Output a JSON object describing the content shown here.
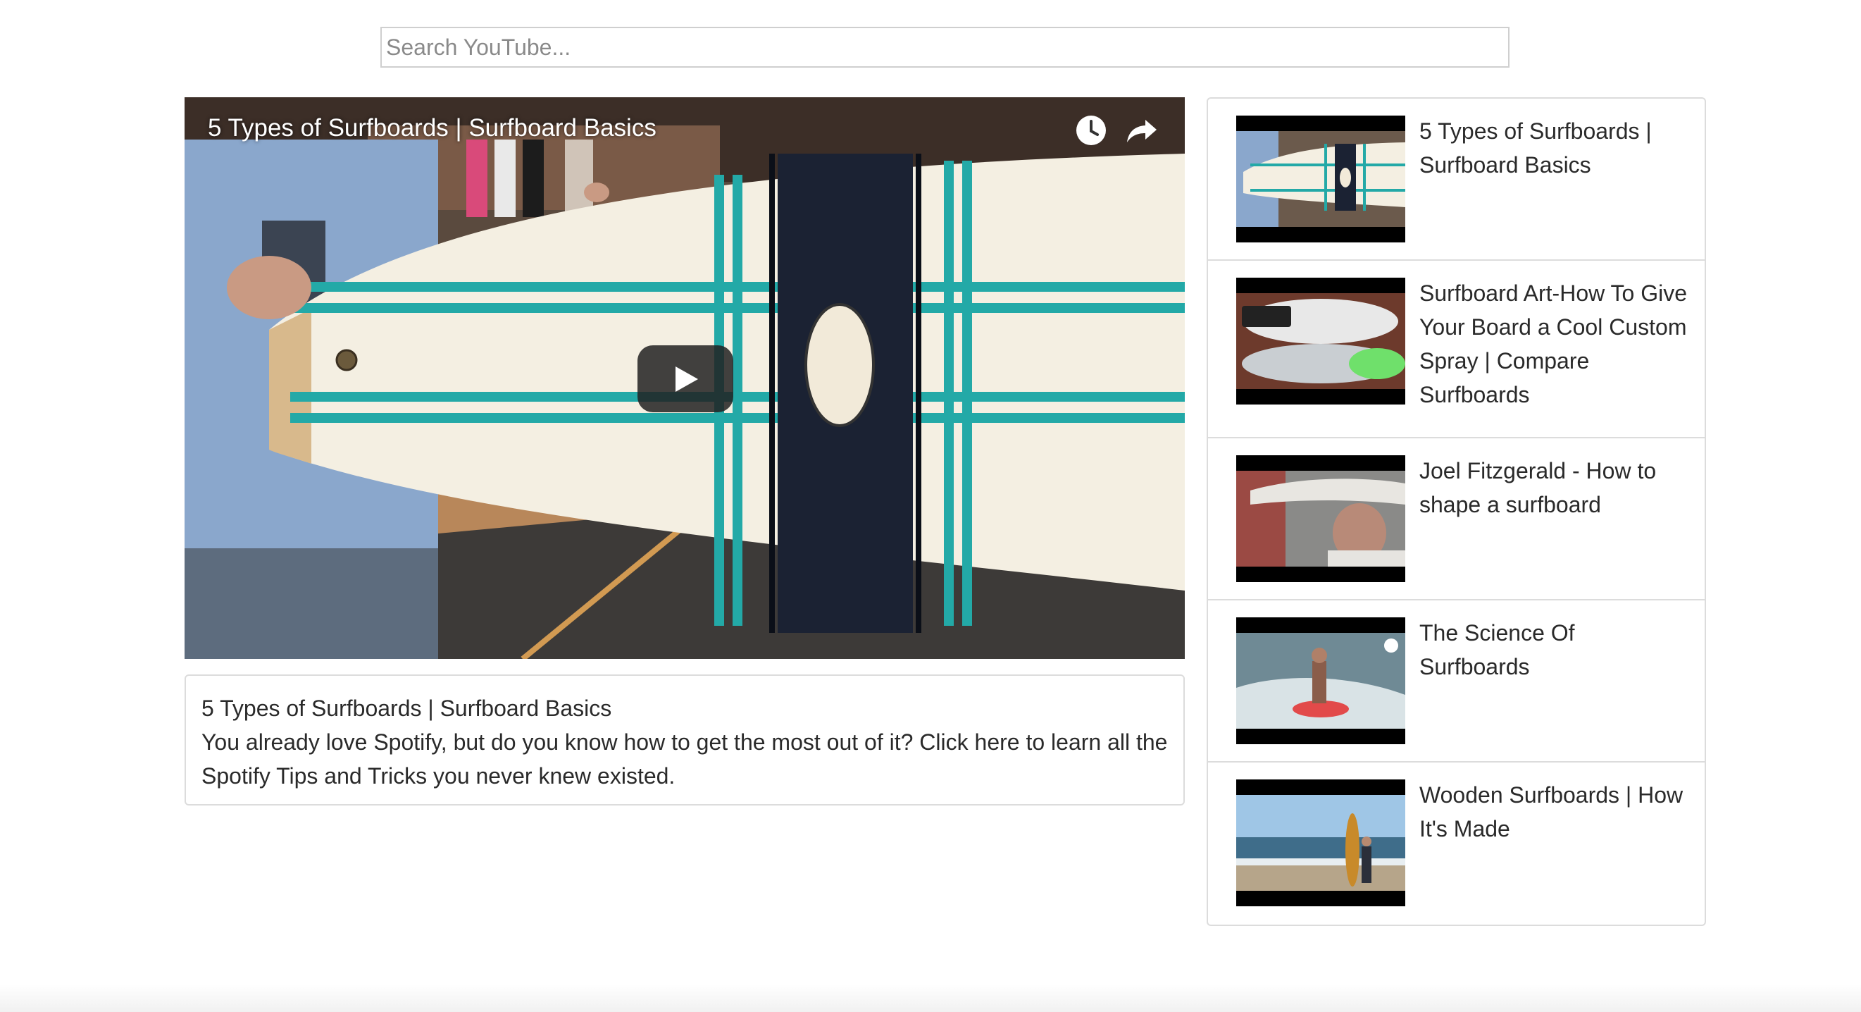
{
  "search": {
    "placeholder": "Search YouTube..."
  },
  "player": {
    "title": "5 Types of Surfboards | Surfboard Basics",
    "watch_later_icon": "clock-icon",
    "share_icon": "share-arrow-icon",
    "play_icon": "play-icon"
  },
  "details": {
    "title": "5 Types of Surfboards | Surfboard Basics",
    "description": "You already love Spotify, but do you know how to get the most out of it? Click here to learn all the Spotify Tips and Tricks you never knew existed."
  },
  "video_list": [
    {
      "title": "5 Types of Surfboards | Surfboard Basics"
    },
    {
      "title": "Surfboard Art-How To Give Your Board a Cool Custom Spray | Compare Surfboards"
    },
    {
      "title": "Joel Fitzgerald - How to shape a surfboard"
    },
    {
      "title": "The Science Of Surfboards"
    },
    {
      "title": "Wooden Surfboards | How It's Made"
    }
  ],
  "colors": {
    "border": "#dcdcdc",
    "teal_stripe": "#23a9a7",
    "text": "#2a2a2a"
  }
}
